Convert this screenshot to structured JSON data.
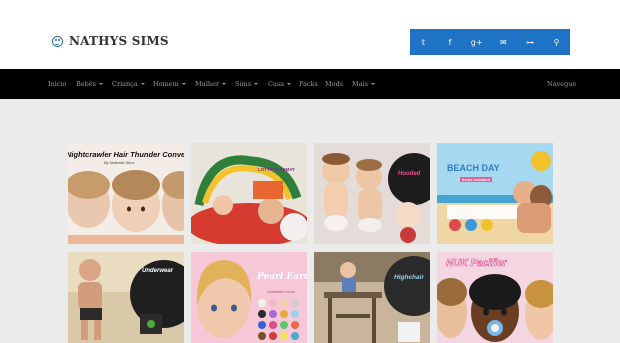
{
  "site": {
    "title": "NATHYS SIMS",
    "icon": "smiley-icon",
    "accent": "#1e73c6"
  },
  "social": [
    {
      "name": "twitter-icon",
      "glyph": "𝕥"
    },
    {
      "name": "facebook-icon",
      "glyph": "f"
    },
    {
      "name": "google-plus-icon",
      "glyph": "g+"
    },
    {
      "name": "email-icon",
      "glyph": "✉"
    },
    {
      "name": "sitemap-icon",
      "glyph": "⊶"
    },
    {
      "name": "search-icon",
      "glyph": "⚲"
    }
  ],
  "nav": {
    "items": [
      {
        "label": "Inicio",
        "dropdown": false
      },
      {
        "label": "Bebês",
        "dropdown": true
      },
      {
        "label": "Criança",
        "dropdown": true
      },
      {
        "label": "Homem",
        "dropdown": true
      },
      {
        "label": "Mulher",
        "dropdown": true
      },
      {
        "label": "Sims",
        "dropdown": true
      },
      {
        "label": "Casa",
        "dropdown": true
      },
      {
        "label": "Packs",
        "dropdown": false
      },
      {
        "label": "Mods",
        "dropdown": false
      },
      {
        "label": "Mais",
        "dropdown": true
      }
    ],
    "right": "Navegue"
  },
  "posts": [
    {
      "label": "Nightcrawler Hair Thunder Conversion",
      "sub": "By Nathalia Sims"
    },
    {
      "label": "LOTTY PLAYMAT",
      "sub": "MAKING ME\nPOSE"
    },
    {
      "label": "Hooded",
      "sub": ""
    },
    {
      "label": "BEACH DAY",
      "sub": "Items included"
    },
    {
      "label": "Underwear",
      "sub": ""
    },
    {
      "label": "Pearl Earrings",
      "sub": "Available colors"
    },
    {
      "label": "Highchair",
      "sub": ""
    },
    {
      "label": "NUK Pacifier",
      "sub": ""
    }
  ]
}
